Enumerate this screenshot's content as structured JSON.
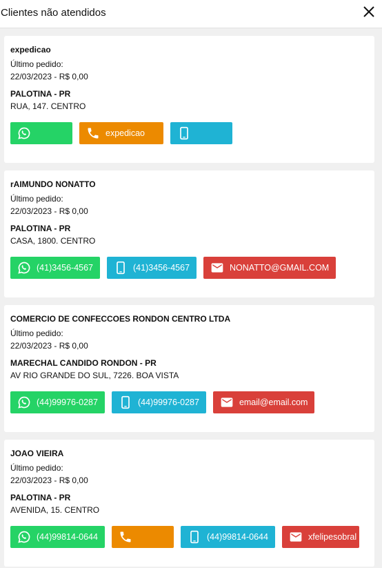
{
  "header": {
    "title": "Clientes não atendidos"
  },
  "colors": {
    "whatsapp": "#25d366",
    "phone": "#ec8a00",
    "mobile": "#1fb3d4",
    "email": "#d9403a"
  },
  "icons": {
    "close": "close-icon",
    "whatsapp": "whatsapp-icon",
    "phone": "phone-icon",
    "mobile": "mobile-phone-icon",
    "email": "email-icon"
  },
  "clients": [
    {
      "name": "expedicao",
      "last_order_label": "Último pedido:",
      "last_order": "22/03/2023 - R$ 0,00",
      "city": "PALOTINA - PR",
      "address": "RUA, 147. CENTRO",
      "whatsapp": "",
      "phone": "expedicao",
      "mobile": ""
    },
    {
      "name": "rAIMUNDO NONATTO",
      "last_order_label": "Último pedido:",
      "last_order": "22/03/2023 - R$ 0,00",
      "city": "PALOTINA - PR",
      "address": "CASA, 1800. CENTRO",
      "whatsapp": "(41)3456-4567",
      "mobile": "(41)3456-4567",
      "email": "NONATTO@GMAIL.COM"
    },
    {
      "name": "COMERCIO DE CONFECCOES RONDON CENTRO LTDA",
      "last_order_label": "Último pedido:",
      "last_order": "22/03/2023 - R$ 0,00",
      "city": "MARECHAL CANDIDO RONDON - PR",
      "address": "AV RIO GRANDE DO SUL, 7226. BOA VISTA",
      "whatsapp": "(44)99976-0287",
      "mobile": "(44)99976-0287",
      "email": "email@email.com"
    },
    {
      "name": "JOAO VIEIRA",
      "last_order_label": "Último pedido:",
      "last_order": "22/03/2023 - R$ 0,00",
      "city": "PALOTINA - PR",
      "address": "AVENIDA, 15. CENTRO",
      "whatsapp": "(44)99814-0644",
      "phone": "",
      "mobile": "(44)99814-0644",
      "email": "xfelipesobral"
    }
  ]
}
